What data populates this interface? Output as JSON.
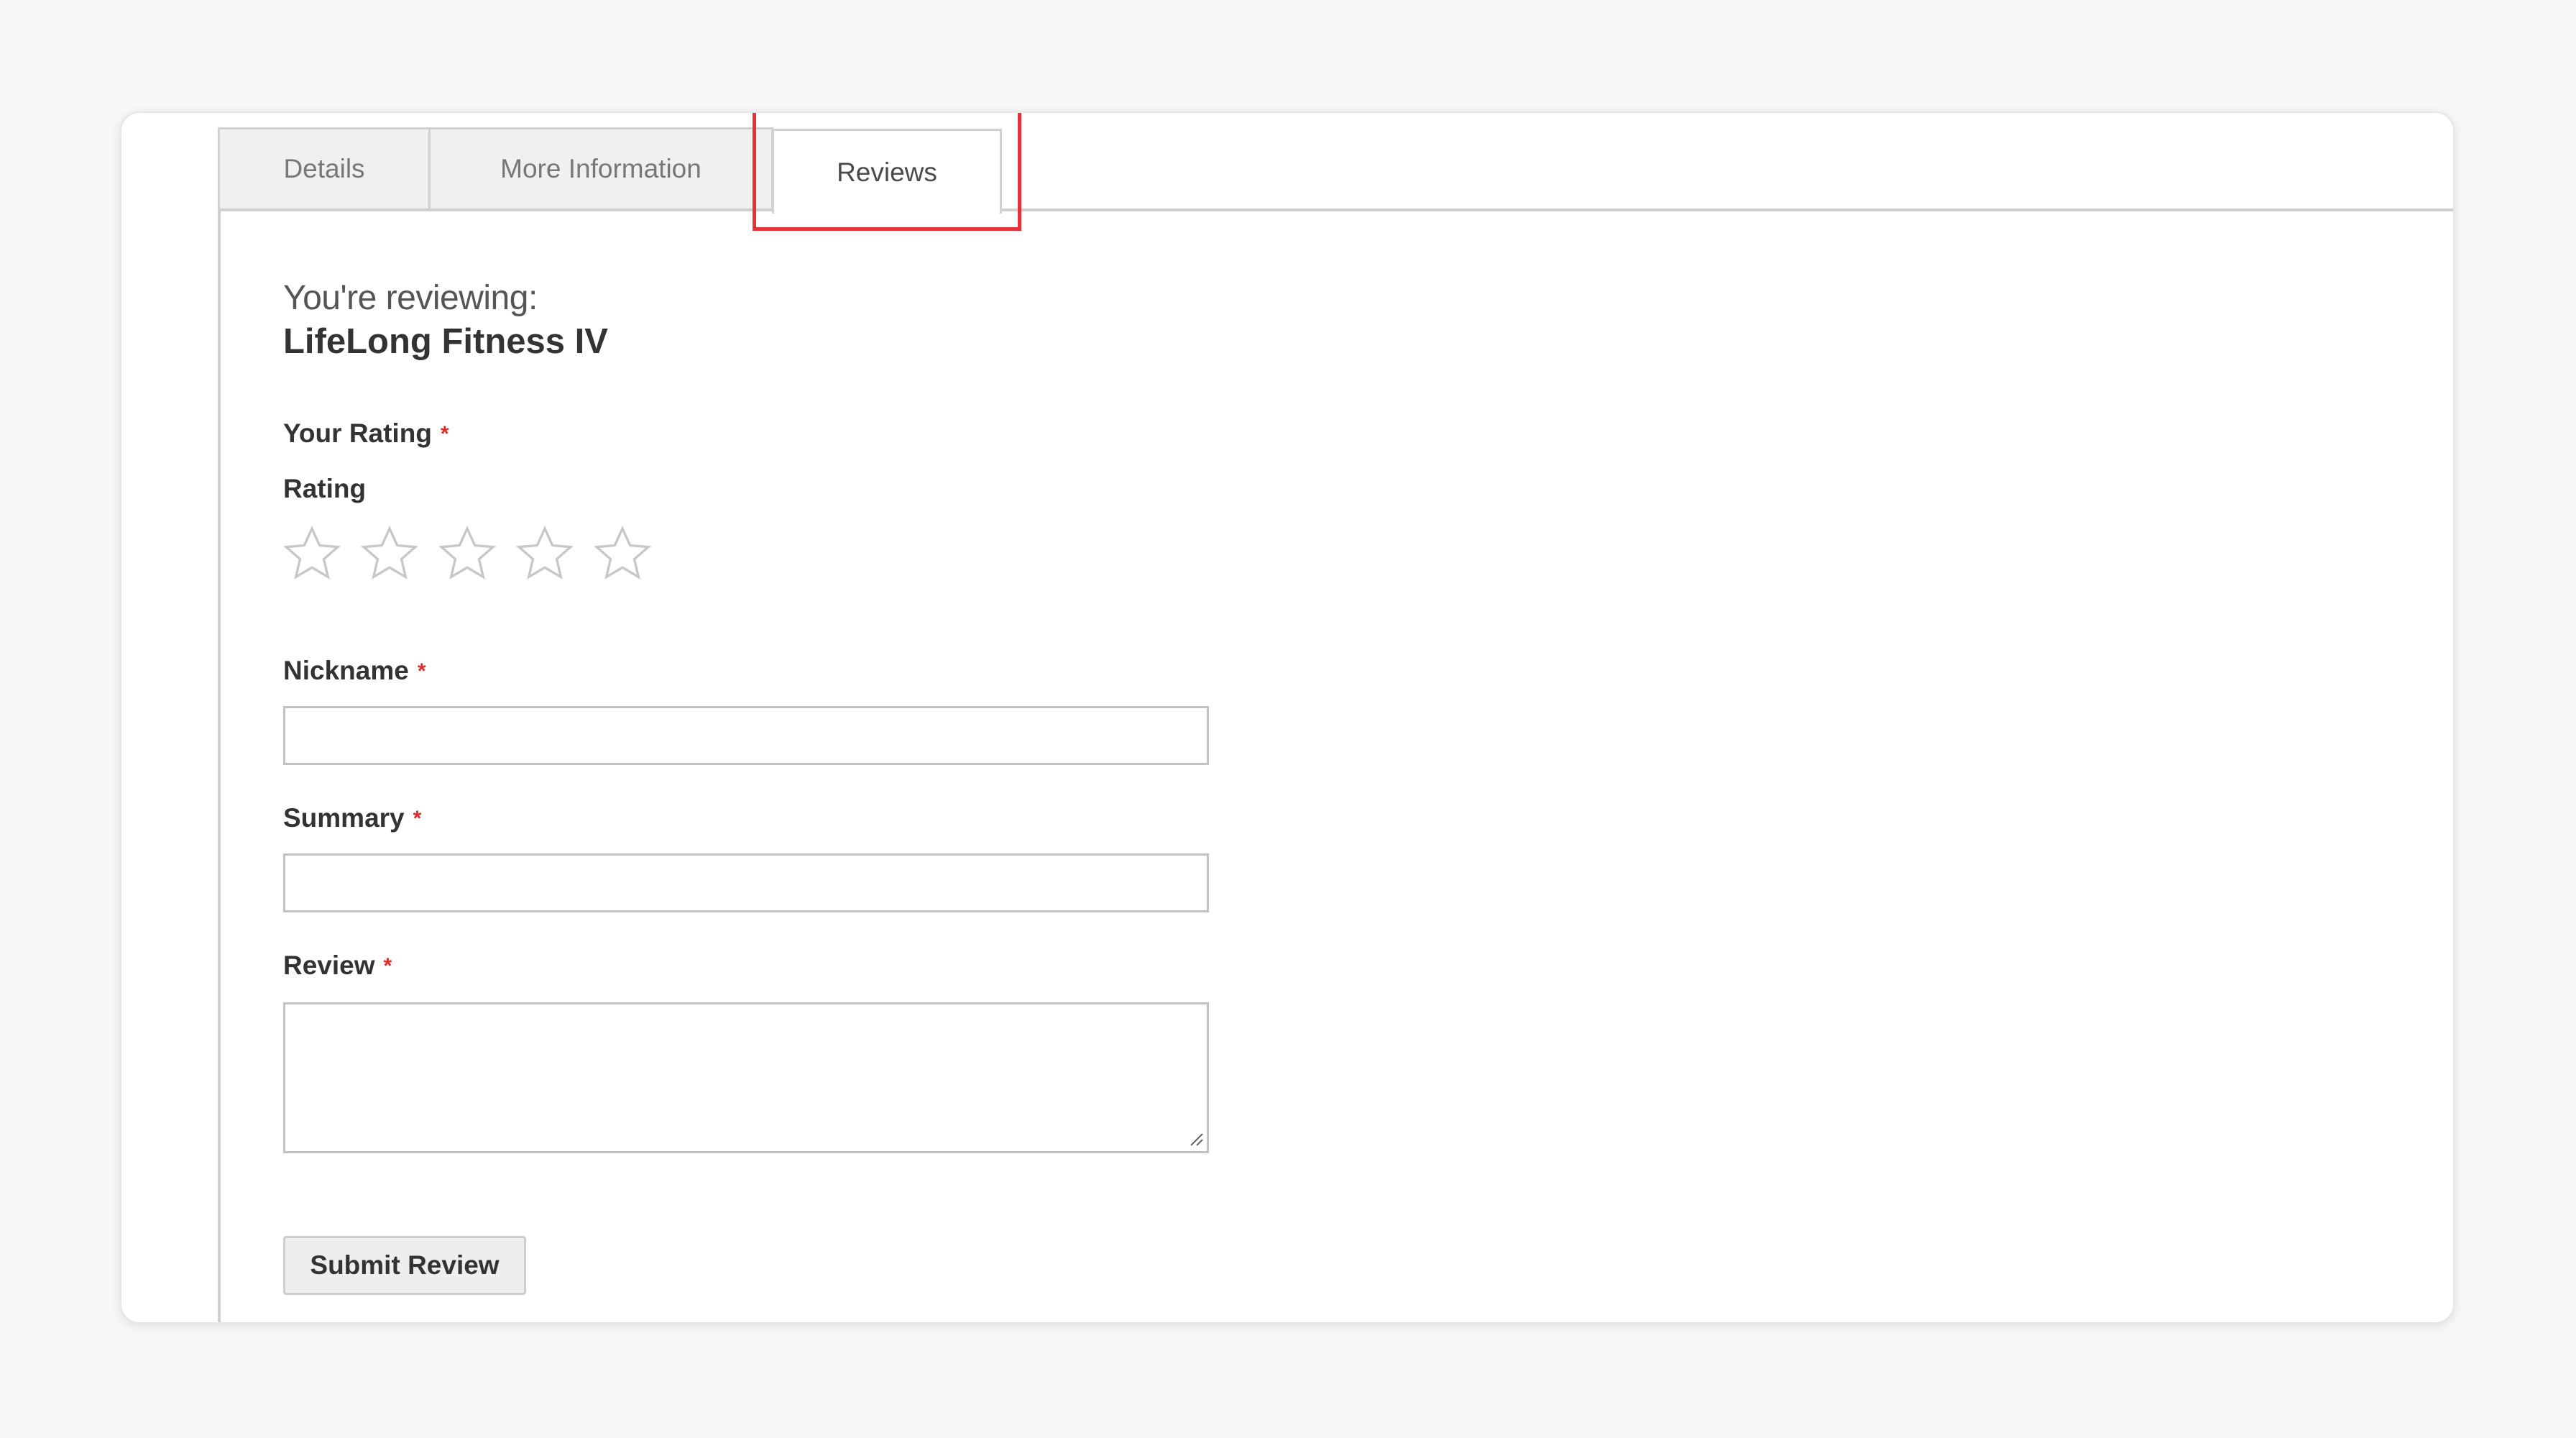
{
  "tabs": {
    "details": "Details",
    "more_information": "More Information",
    "reviews": "Reviews",
    "active": "Reviews",
    "highlight_color": "#e53238"
  },
  "review_form": {
    "reviewing_label": "You're reviewing:",
    "product_name": "LifeLong Fitness IV",
    "your_rating_label": "Your Rating",
    "rating_label": "Rating",
    "required_marker": "*",
    "rating": {
      "max_stars": 5,
      "selected": 0,
      "star_icon": "star-outline-icon"
    },
    "nickname_label": "Nickname",
    "nickname_value": "",
    "summary_label": "Summary",
    "summary_value": "",
    "review_label": "Review",
    "review_value": "",
    "submit_label": "Submit Review"
  },
  "colors": {
    "required": "#e02b27",
    "border": "#c2c2c2",
    "background": "#f7f7f7"
  }
}
